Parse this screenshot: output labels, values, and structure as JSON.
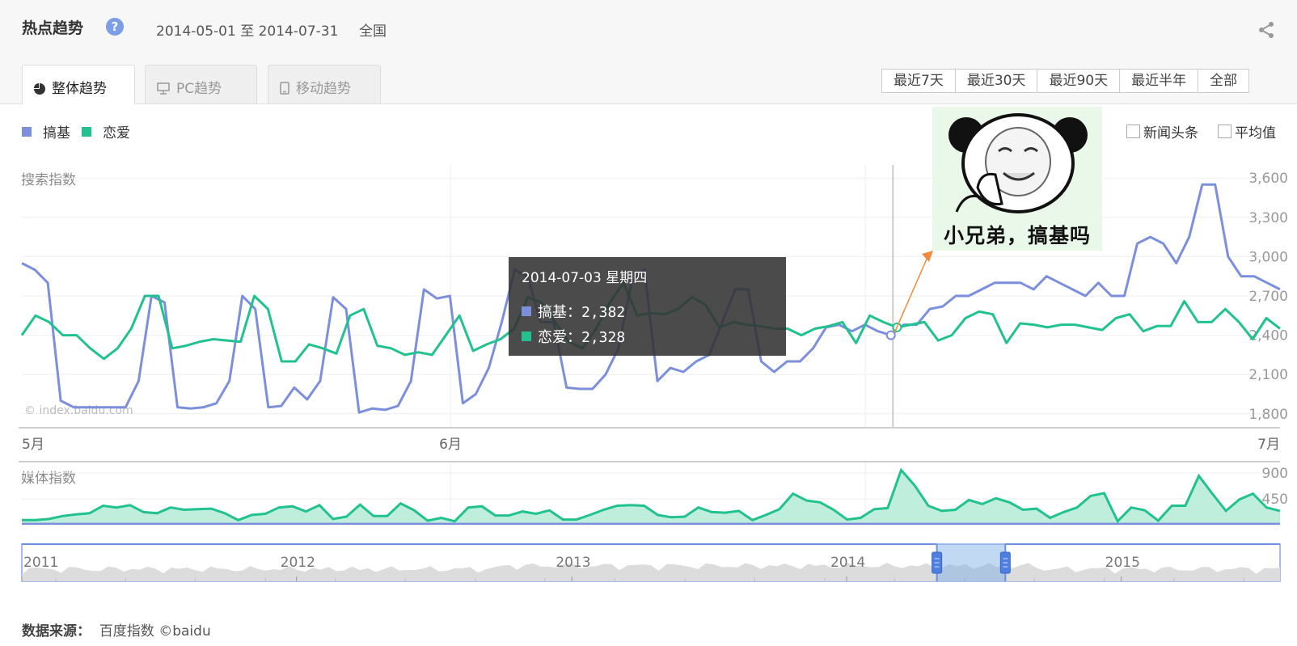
{
  "header": {
    "title": "热点趋势",
    "help": "?",
    "date_range": "2014-05-01 至 2014-07-31",
    "region": "全国"
  },
  "tabs": [
    {
      "label": "整体趋势",
      "icon": "pie-icon",
      "active": true
    },
    {
      "label": "PC趋势",
      "icon": "monitor-icon",
      "active": false
    },
    {
      "label": "移动趋势",
      "icon": "mobile-icon",
      "active": false
    }
  ],
  "range_buttons": [
    "最近7天",
    "最近30天",
    "最近90天",
    "最近半年",
    "全部"
  ],
  "legend": [
    {
      "name": "搞基",
      "color": "#7b8fdc"
    },
    {
      "name": "恋爱",
      "color": "#21c28f"
    }
  ],
  "options": {
    "news_label": "新闻头条",
    "avg_label": "平均值"
  },
  "meme": {
    "caption": "小兄弟，搞基吗"
  },
  "tooltip": {
    "date": "2014-07-03 星期四",
    "rows": [
      {
        "label": "搞基：2,382",
        "color": "#7b8fdc"
      },
      {
        "label": "恋爱：2,328",
        "color": "#21c28f"
      }
    ]
  },
  "watermark": "© index.baidu.com",
  "footer": {
    "source_label": "数据来源：",
    "source_value": "百度指数 ©baidu"
  },
  "chart_data": [
    {
      "type": "line",
      "title": "",
      "ylabel": "搜索指数",
      "ylim": [
        1700,
        3700
      ],
      "yticks": [
        "1,800",
        "2,100",
        "2,400",
        "2,700",
        "3,000",
        "3,300",
        "3,600"
      ],
      "ytick_values": [
        1800,
        2100,
        2400,
        2700,
        3000,
        3300,
        3600
      ],
      "x_start": "2014-05-01",
      "x_end": "2014-07-31",
      "xticks": [
        "5月",
        "6月",
        "7月"
      ],
      "xtick_dates": [
        "2014-05-01",
        "2014-06-01",
        "2014-07-31"
      ],
      "highlight_date": "2014-07-03",
      "series": [
        {
          "name": "搞基",
          "color": "#7b8fdc",
          "values": [
            2950,
            2900,
            2800,
            1900,
            1850,
            1850,
            1850,
            1850,
            1850,
            2050,
            2700,
            2650,
            1850,
            1840,
            1850,
            1880,
            2050,
            2700,
            2600,
            1850,
            1860,
            2000,
            1910,
            2050,
            2690,
            2600,
            1810,
            1840,
            1830,
            1860,
            2050,
            2750,
            2680,
            2700,
            1880,
            1950,
            2150,
            2500,
            2900,
            2850,
            2500,
            2500,
            2000,
            1990,
            1990,
            2100,
            2300,
            2800,
            2900,
            2050,
            2150,
            2120,
            2200,
            2250,
            2500,
            2750,
            2750,
            2200,
            2120,
            2200,
            2200,
            2300,
            2460,
            2480,
            2430,
            2480,
            2430,
            2400,
            2480,
            2480,
            2600,
            2620,
            2700,
            2700,
            2750,
            2800,
            2800,
            2800,
            2750,
            2850,
            2800,
            2750,
            2700,
            2800,
            2700,
            2700,
            3100,
            3150,
            3100,
            2950,
            3150,
            3550,
            3550,
            3000,
            2850,
            2850,
            2800,
            2750
          ]
        },
        {
          "name": "恋爱",
          "color": "#21c28f",
          "values": [
            2400,
            2550,
            2500,
            2400,
            2400,
            2300,
            2220,
            2300,
            2450,
            2700,
            2700,
            2300,
            2320,
            2350,
            2370,
            2360,
            2350,
            2700,
            2600,
            2200,
            2200,
            2330,
            2300,
            2260,
            2550,
            2600,
            2320,
            2300,
            2250,
            2270,
            2250,
            2400,
            2550,
            2280,
            2330,
            2370,
            2450,
            2690,
            2650,
            2500,
            2350,
            2300,
            2450,
            2650,
            2800,
            2550,
            2570,
            2560,
            2600,
            2690,
            2630,
            2460,
            2500,
            2480,
            2470,
            2450,
            2450,
            2400,
            2450,
            2470,
            2500,
            2340,
            2550,
            2500,
            2460,
            2480,
            2500,
            2360,
            2400,
            2530,
            2580,
            2560,
            2340,
            2490,
            2480,
            2460,
            2480,
            2480,
            2460,
            2440,
            2530,
            2560,
            2430,
            2470,
            2470,
            2660,
            2500,
            2500,
            2600,
            2500,
            2370,
            2530,
            2450
          ]
        }
      ]
    },
    {
      "type": "area",
      "title": "",
      "ylabel": "媒体指数",
      "ylim": [
        0,
        900
      ],
      "yticks": [
        "450",
        "900"
      ],
      "ytick_values": [
        450,
        900
      ],
      "x_start": "2014-05-01",
      "x_end": "2014-07-31",
      "series": [
        {
          "name": "恋爱",
          "color": "#21c28f",
          "values": [
            80,
            80,
            100,
            150,
            180,
            200,
            330,
            300,
            340,
            220,
            200,
            300,
            260,
            270,
            280,
            200,
            80,
            170,
            190,
            300,
            320,
            230,
            340,
            100,
            140,
            350,
            150,
            150,
            370,
            250,
            70,
            120,
            60,
            300,
            320,
            160,
            160,
            230,
            190,
            250,
            90,
            90,
            170,
            260,
            330,
            340,
            330,
            170,
            130,
            140,
            300,
            220,
            210,
            240,
            80,
            170,
            270,
            540,
            420,
            390,
            260,
            90,
            120,
            270,
            290,
            950,
            680,
            330,
            240,
            260,
            430,
            360,
            460,
            390,
            260,
            280,
            120,
            220,
            300,
            500,
            550,
            60,
            300,
            250,
            70,
            330,
            330,
            850,
            540,
            240,
            440,
            540,
            300,
            240
          ]
        },
        {
          "name": "搞基",
          "color": "#7b8fdc",
          "values": [
            15,
            15,
            15,
            15,
            15,
            15,
            15,
            15,
            15,
            15,
            15,
            15,
            15,
            15,
            15,
            15,
            15,
            15,
            15,
            15,
            15,
            15,
            15,
            15,
            15,
            15,
            15,
            15,
            15,
            15,
            15,
            15,
            15,
            15,
            15,
            15,
            15,
            15,
            15,
            15,
            15,
            15,
            15,
            15,
            15,
            15,
            15,
            15,
            15,
            15,
            15,
            15,
            15,
            15,
            15,
            15,
            15,
            15,
            15,
            15,
            15,
            15,
            15,
            15,
            15,
            15,
            15,
            15,
            15,
            15,
            15,
            15,
            15,
            15,
            15,
            15,
            15,
            15,
            15,
            15,
            15,
            15,
            15,
            15,
            15,
            15,
            15,
            15,
            15,
            15,
            15,
            15,
            15,
            15
          ]
        }
      ]
    },
    {
      "type": "area",
      "title": "",
      "xticks": [
        "2011",
        "2012",
        "2013",
        "2014",
        "2015"
      ],
      "selected_range": [
        "2014-05-01",
        "2014-07-31"
      ]
    }
  ]
}
